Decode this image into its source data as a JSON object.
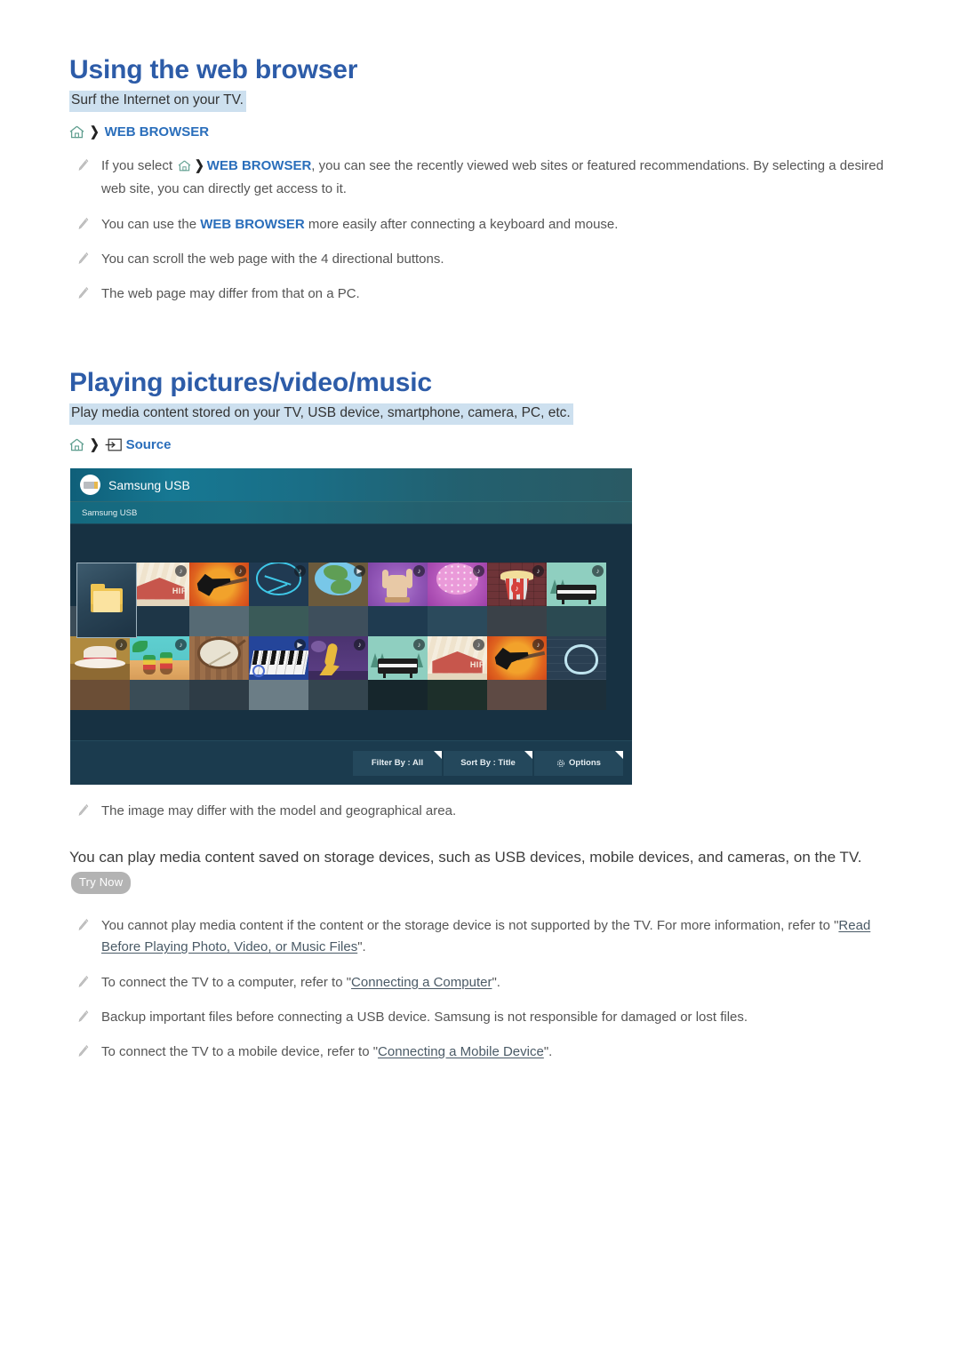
{
  "sections": [
    {
      "title": "Using the web browser",
      "subtitle": "Surf the Internet on your TV.",
      "path": {
        "home_icon": "home-icon",
        "chevron": "❯",
        "label": "WEB BROWSER"
      },
      "bullets": [
        {
          "pre": "If you select ",
          "home_icon": "home-icon",
          "chevron": "❯",
          "emph": "WEB BROWSER",
          "post": ", you can see the recently viewed web sites or featured recommendations. By selecting a desired web site, you can directly get access to it."
        },
        {
          "pre": "You can use the ",
          "emph": "WEB BROWSER",
          "post": " more easily after connecting a keyboard and mouse."
        },
        {
          "pre": "You can scroll the web page with the 4 directional buttons."
        },
        {
          "pre": "The web page may differ from that on a PC."
        }
      ]
    },
    {
      "title": "Playing pictures/video/music",
      "subtitle": "Play media content stored on your TV, USB device, smartphone, camera, PC, etc.",
      "path": {
        "home_icon": "home-icon",
        "chevron": "❯",
        "source_icon": "source-input-icon",
        "label": "Source"
      },
      "image_note": "The image may differ with the model and geographical area.",
      "paragraph": {
        "text": "You can play media content saved on storage devices, such as USB devices, mobile devices, and cameras, on the TV.",
        "badge": "Try Now"
      },
      "bullets": [
        {
          "pre": "You cannot play media content if the content or the storage device is not supported by the TV. For more information, refer to \"",
          "xref": "Read Before Playing Photo, Video, or Music Files",
          "post": "\"."
        },
        {
          "pre": "To connect the TV to a computer, refer to \"",
          "xref": "Connecting a Computer",
          "post": "\"."
        },
        {
          "pre": "Backup important files before connecting a USB device. Samsung is not responsible for damaged or lost files."
        },
        {
          "pre": "To connect the TV to a mobile device, refer to \"",
          "xref": "Connecting a Mobile Device",
          "post": "\"."
        }
      ]
    }
  ],
  "tv_screen": {
    "device_title": "Samsung USB",
    "breadcrumb": "Samsung USB",
    "usb_icon": "usb-drive-icon",
    "selected_tile": {
      "name": "folder-tile",
      "icon": "folder-icon"
    },
    "tiles_row1": [
      {
        "name": "hip-hop-house",
        "badge": "♪"
      },
      {
        "name": "electric-guitar-flames",
        "badge": "♪"
      },
      {
        "name": "blue-line-art",
        "badge": "♪"
      },
      {
        "name": "earth-globe",
        "badge": "▶"
      },
      {
        "name": "rock-hand",
        "badge": "♪"
      },
      {
        "name": "disco-ball",
        "badge": "♪"
      },
      {
        "name": "popcorn-music",
        "badge": "♪"
      },
      {
        "name": "grand-piano-trees",
        "badge": "♪"
      }
    ],
    "tiles_row2": [
      {
        "name": "cowboy-hat",
        "badge": "♪"
      },
      {
        "name": "conga-drums",
        "badge": "♪"
      },
      {
        "name": "banjo-wood",
        "badge": ""
      },
      {
        "name": "piano-keys-blue",
        "badge": "▶"
      },
      {
        "name": "saxophone-night",
        "badge": "♪"
      },
      {
        "name": "grand-piano-forest",
        "badge": "♪"
      },
      {
        "name": "hip-hop-house-2",
        "badge": "♪"
      },
      {
        "name": "electric-guitar-flames-2",
        "badge": "♪"
      }
    ],
    "toolbar": {
      "filter_button": "Filter By : All",
      "sort_button": "Sort By : Title",
      "options_button": "Options",
      "options_icon": "gear-icon"
    },
    "colors": {
      "background": "#173142",
      "header_teal": "#167893",
      "toolbar_bg": "#1b3b4e",
      "button_bg": "#24485c"
    }
  },
  "theme": {
    "heading_blue": "#2d5ca8",
    "link_blue": "#2a6ebb",
    "highlight_bg": "#cde0ef",
    "badge_grey": "#b3b3b3",
    "body_grey": "#555555"
  }
}
